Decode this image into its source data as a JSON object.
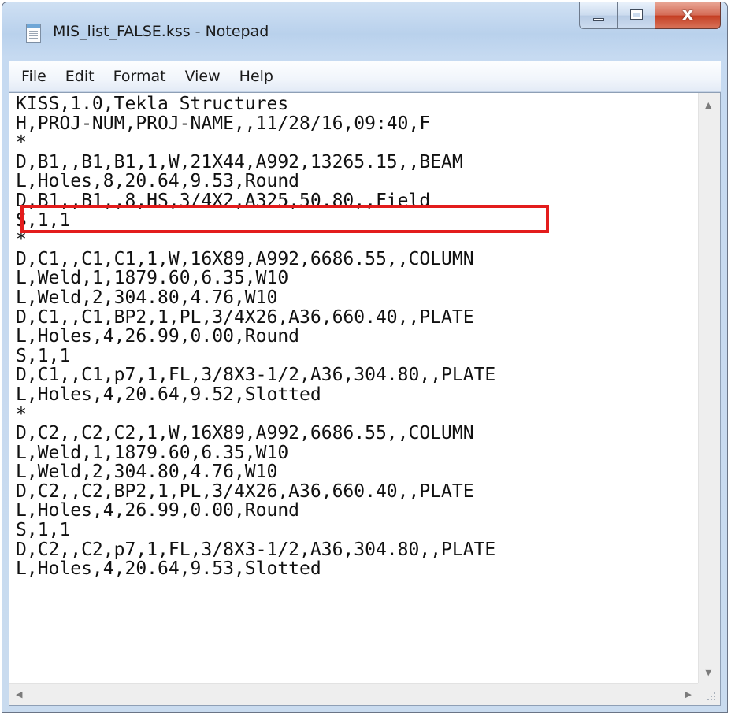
{
  "window": {
    "title": "MIS_list_FALSE.kss - Notepad",
    "icon": "notepad-icon",
    "close_glyph": "x"
  },
  "menu": [
    {
      "label": "File"
    },
    {
      "label": "Edit"
    },
    {
      "label": "Format"
    },
    {
      "label": "View"
    },
    {
      "label": "Help"
    }
  ],
  "editor": {
    "lines": [
      "KISS,1.0,Tekla Structures",
      "H,PROJ-NUM,PROJ-NAME,,11/28/16,09:40,F",
      "*",
      "D,B1,,B1,B1,1,W,21X44,A992,13265.15,,BEAM",
      "L,Holes,8,20.64,9.53,Round",
      "D,B1,,B1,,8,HS,3/4X2,A325,50.80,,Field",
      "S,1,1",
      "*",
      "D,C1,,C1,C1,1,W,16X89,A992,6686.55,,COLUMN",
      "L,Weld,1,1879.60,6.35,W10",
      "L,Weld,2,304.80,4.76,W10",
      "D,C1,,C1,BP2,1,PL,3/4X26,A36,660.40,,PLATE",
      "L,Holes,4,26.99,0.00,Round",
      "S,1,1",
      "D,C1,,C1,p7,1,FL,3/8X3-1/2,A36,304.80,,PLATE",
      "L,Holes,4,20.64,9.52,Slotted",
      "*",
      "D,C2,,C2,C2,1,W,16X89,A992,6686.55,,COLUMN",
      "L,Weld,1,1879.60,6.35,W10",
      "L,Weld,2,304.80,4.76,W10",
      "D,C2,,C2,BP2,1,PL,3/4X26,A36,660.40,,PLATE",
      "L,Holes,4,26.99,0.00,Round",
      "S,1,1",
      "D,C2,,C2,p7,1,FL,3/8X3-1/2,A36,304.80,,PLATE",
      "L,Holes,4,20.64,9.53,Slotted"
    ],
    "highlighted_line_index": 5,
    "highlight_color": "#e31c1c"
  },
  "scrollbars": {
    "up_arrow": "▲",
    "down_arrow": "▼",
    "left_arrow": "◀",
    "right_arrow": "▶"
  }
}
